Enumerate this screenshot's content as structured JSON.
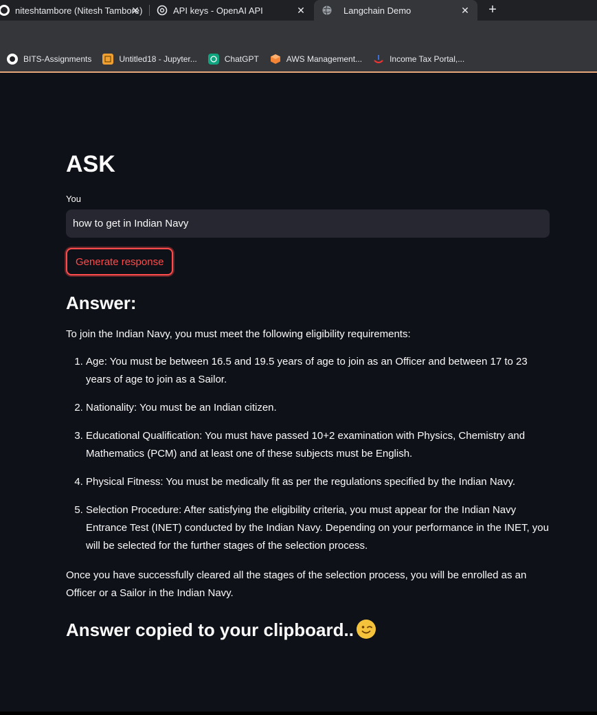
{
  "browser": {
    "tabs": [
      {
        "title": "niteshtambore (Nitesh Tambore)",
        "icon": "github-icon"
      },
      {
        "title": "API keys - OpenAI API",
        "icon": "openai-icon"
      },
      {
        "title": "Langchain Demo",
        "icon": "globe-icon",
        "active": true
      }
    ],
    "bookmarks": [
      {
        "label": "BITS-Assignments"
      },
      {
        "label": "Untitled18 - Jupyter..."
      },
      {
        "label": "ChatGPT"
      },
      {
        "label": "AWS Management..."
      },
      {
        "label": "Income Tax Portal,..."
      }
    ]
  },
  "app": {
    "title": "ASK",
    "input_label": "You",
    "input_value": "how to get in Indian Navy",
    "button_label": "Generate response",
    "answer_heading": "Answer:",
    "intro": "To join the Indian Navy, you must meet the following eligibility requirements:",
    "items": [
      "Age: You must be between 16.5 and 19.5 years of age to join as an Officer and between 17 to 23 years of age to join as a Sailor.",
      "Nationality: You must be an Indian citizen.",
      "Educational Qualification: You must have passed 10+2 examination with Physics, Chemistry and Mathematics (PCM) and at least one of these subjects must be English.",
      "Physical Fitness: You must be medically fit as per the regulations specified by the Indian Navy.",
      "Selection Procedure: After satisfying the eligibility criteria, you must appear for the Indian Navy Entrance Test (INET) conducted by the Indian Navy. Depending on your performance in the INET, you will be selected for the further stages of the selection process."
    ],
    "closing": "Once you have successfully cleared all the stages of the selection process, you will be enrolled as an Officer or a Sailor in the Indian Navy.",
    "copied_heading": "Answer copied to your clipboard..",
    "copied_emoji": "winking-face-icon"
  },
  "colors": {
    "accent": "#ff4b4b",
    "background": "#0e1117",
    "input_bg": "#262730"
  }
}
